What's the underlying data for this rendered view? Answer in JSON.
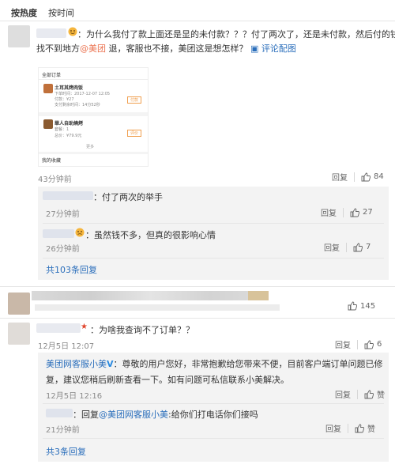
{
  "tabs": {
    "hot": "按热度",
    "time": "按时间"
  },
  "c1": {
    "text_1": "：为什么我付了款上面还是显的未付款？？？付了两次了，还是未付款，然后付的钱又",
    "text_2a": "找不到地方",
    "mention": "@美团",
    "text_2b": " 退，客服也不接，美团这是想怎样？ ",
    "view_image": "评论配图",
    "time": "43分钟前",
    "reply": "回复",
    "likes": "84",
    "thumb": {
      "header": "全部订单",
      "o1_title": "土耳其烤肉饭",
      "o1_line1": "下单时间：2017-12-07 12:05",
      "o1_line2": "付款：¥27",
      "o1_line3": "支付剩余时间：14分52秒",
      "o1_btn": "付款",
      "o2_title": "華人自助燒烤",
      "o2_line1": "套餐：1",
      "o2_line2": "总价：¥79.9元",
      "o2_btn": "评价",
      "more": "更多",
      "footer": "我的收藏"
    }
  },
  "r1": {
    "text": "：付了两次的举手",
    "time": "27分钟前",
    "reply": "回复",
    "likes": "27"
  },
  "r2": {
    "text": "：虽然钱不多，但真的很影响心情",
    "time": "26分钟前",
    "reply": "回复",
    "likes": "7"
  },
  "more1": "共103条回复",
  "c2": {
    "likes": "145"
  },
  "c3": {
    "text": "：为啥我查询不了订单？？",
    "time": "12月5日 12:07",
    "reply": "回复",
    "likes": "6",
    "official": {
      "name": "美团网客服小美",
      "badge": "V",
      "text_1": "：尊敬的用户您好，非常抱歉给您带来不便，目前客户端订单问题已修",
      "text_2": "复，建议您稍后刷新查看一下。如有问题可私信联系小美解决。",
      "time": "12月5日 12:16",
      "reply": "回复",
      "likes": "赞"
    },
    "sub": {
      "prefix": "：回复",
      "mention": "@美团网客服小美",
      "text": ":给你们打电话你们接吗",
      "time": "21分钟前",
      "reply": "回复",
      "likes": "赞"
    },
    "more": "共3条回复"
  }
}
